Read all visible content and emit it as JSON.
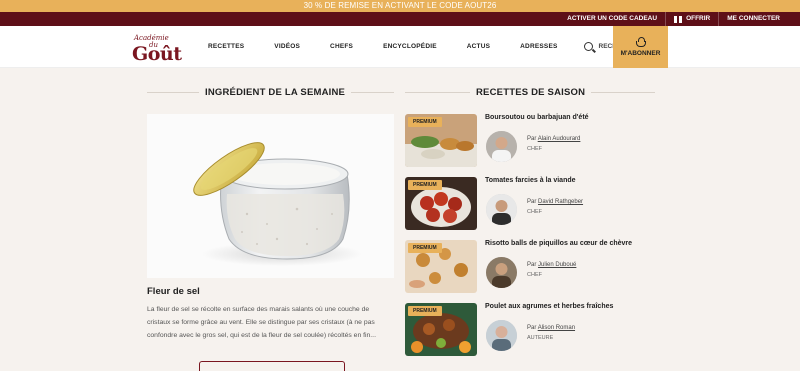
{
  "promo": {
    "text": "30 % DE REMISE EN ACTIVANT LE CODE AOUT26"
  },
  "topbar": {
    "activate_code": "ACTIVER UN CODE CADEAU",
    "offer": "OFFRIR",
    "login": "ME CONNECTER"
  },
  "logo": {
    "line1": "Académie",
    "line2": "du",
    "line3": "Goût"
  },
  "nav": {
    "items": [
      "RECETTES",
      "VIDÉOS",
      "CHEFS",
      "ENCYCLOPÉDIE",
      "ACTUS",
      "ADRESSES"
    ],
    "search": "RECHERCHE",
    "subscribe": "M'ABONNER"
  },
  "ingredient": {
    "section_title": "INGRÉDIENT DE LA SEMAINE",
    "name": "Fleur de sel",
    "description": "La fleur de sel se récolte en surface des marais salants où une couche de cristaux se forme grâce au vent. Elle se distingue par ses cristaux (à ne pas confondre avec le gros sel, qui est de la fleur de sel coulée) récoltés en fin..."
  },
  "season": {
    "section_title": "RECETTES DE SAISON",
    "recipes": [
      {
        "badge": "PREMIUM",
        "title": "Boursoutou ou barbajuan d'été",
        "by": "Par",
        "author": "Alain Audourard",
        "role": "CHEF"
      },
      {
        "badge": "PREMIUM",
        "title": "Tomates farcies à la viande",
        "by": "Par",
        "author": "David Rathgeber",
        "role": "CHEF"
      },
      {
        "badge": "PREMIUM",
        "title": "Risotto balls de piquillos au cœur de chèvre",
        "by": "Par",
        "author": "Julien Duboué",
        "role": "CHEF"
      },
      {
        "badge": "PREMIUM",
        "title": "Poulet aux agrumes et herbes fraîches",
        "by": "Par",
        "author": "Alison Roman",
        "role": "AUTEURE"
      }
    ]
  },
  "colors": {
    "gold": "#e8b15a",
    "burgundy": "#5e0f18",
    "background": "#f6f2ee"
  }
}
